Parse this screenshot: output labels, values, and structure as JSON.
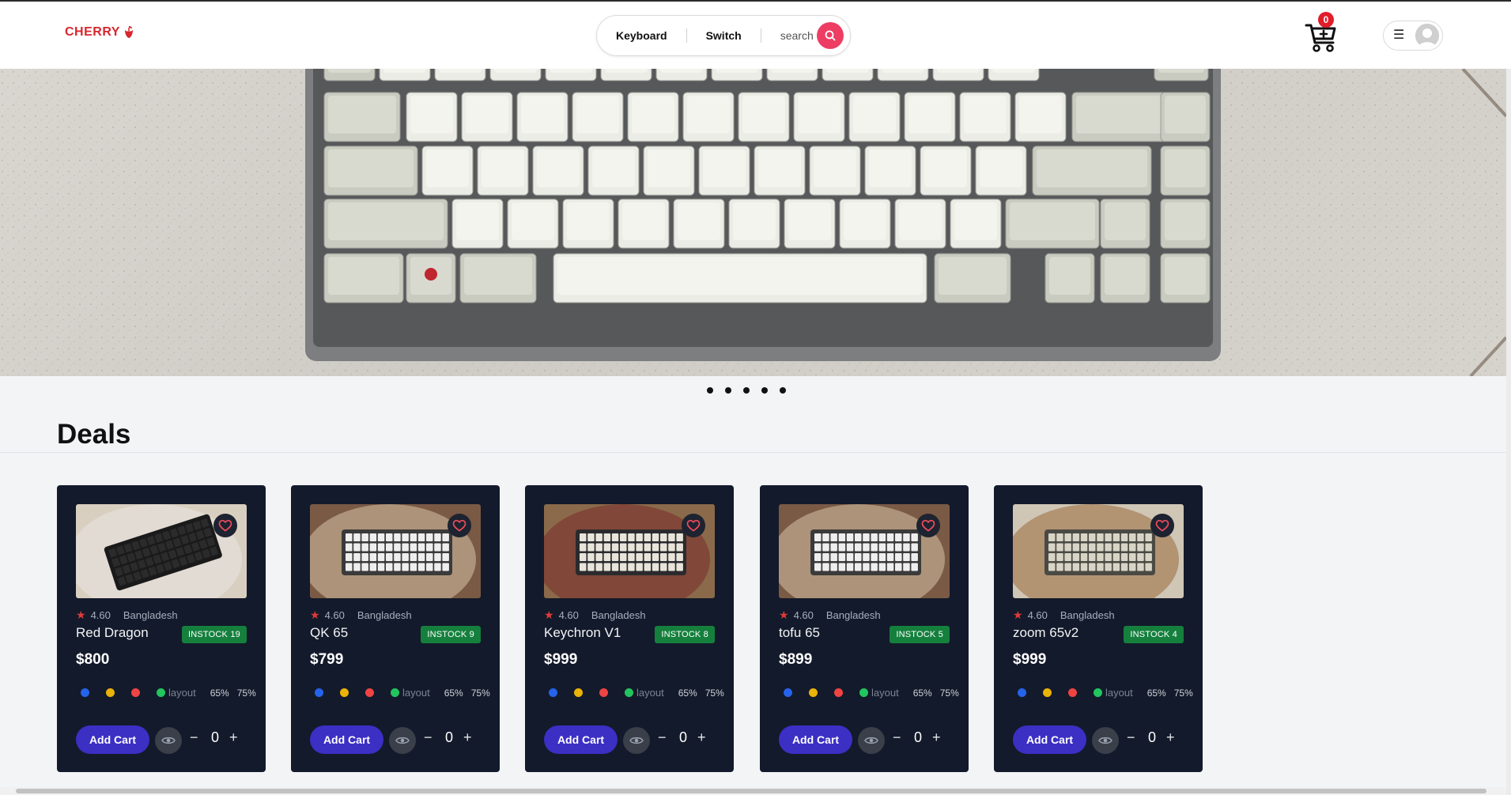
{
  "header": {
    "logo_text": "CHERRY",
    "nav": [
      "Keyboard",
      "Switch"
    ],
    "search_placeholder": "search",
    "cart_count": "0"
  },
  "hero": {
    "slides_count": 5
  },
  "section": {
    "title": "Deals"
  },
  "products": [
    {
      "name": "Red Dragon",
      "rating": "4.60",
      "location": "Bangladesh",
      "stock": "INSTOCK 19",
      "price": "$800"
    },
    {
      "name": "QK 65",
      "rating": "4.60",
      "location": "Bangladesh",
      "stock": "INSTOCK 9",
      "price": "$799"
    },
    {
      "name": "Keychron V1",
      "rating": "4.60",
      "location": "Bangladesh",
      "stock": "INSTOCK 8",
      "price": "$999"
    },
    {
      "name": "tofu 65",
      "rating": "4.60",
      "location": "Bangladesh",
      "stock": "INSTOCK 5",
      "price": "$899"
    },
    {
      "name": "zoom 65v2",
      "rating": "4.60",
      "location": "Bangladesh",
      "stock": "INSTOCK 4",
      "price": "$999"
    }
  ],
  "card_labels": {
    "layout": "layout",
    "layout_a": "65%",
    "layout_b": "75%",
    "add_cart": "Add Cart",
    "quantity": "0",
    "minus": "−",
    "plus": "+"
  },
  "colors": {
    "accent": "#3b2fc4",
    "search": "#ee3d63",
    "stock": "#15803d",
    "card_bg": "#131a2b",
    "swatches": [
      "#2563eb",
      "#eab308",
      "#ef4444",
      "#22c55e"
    ]
  }
}
